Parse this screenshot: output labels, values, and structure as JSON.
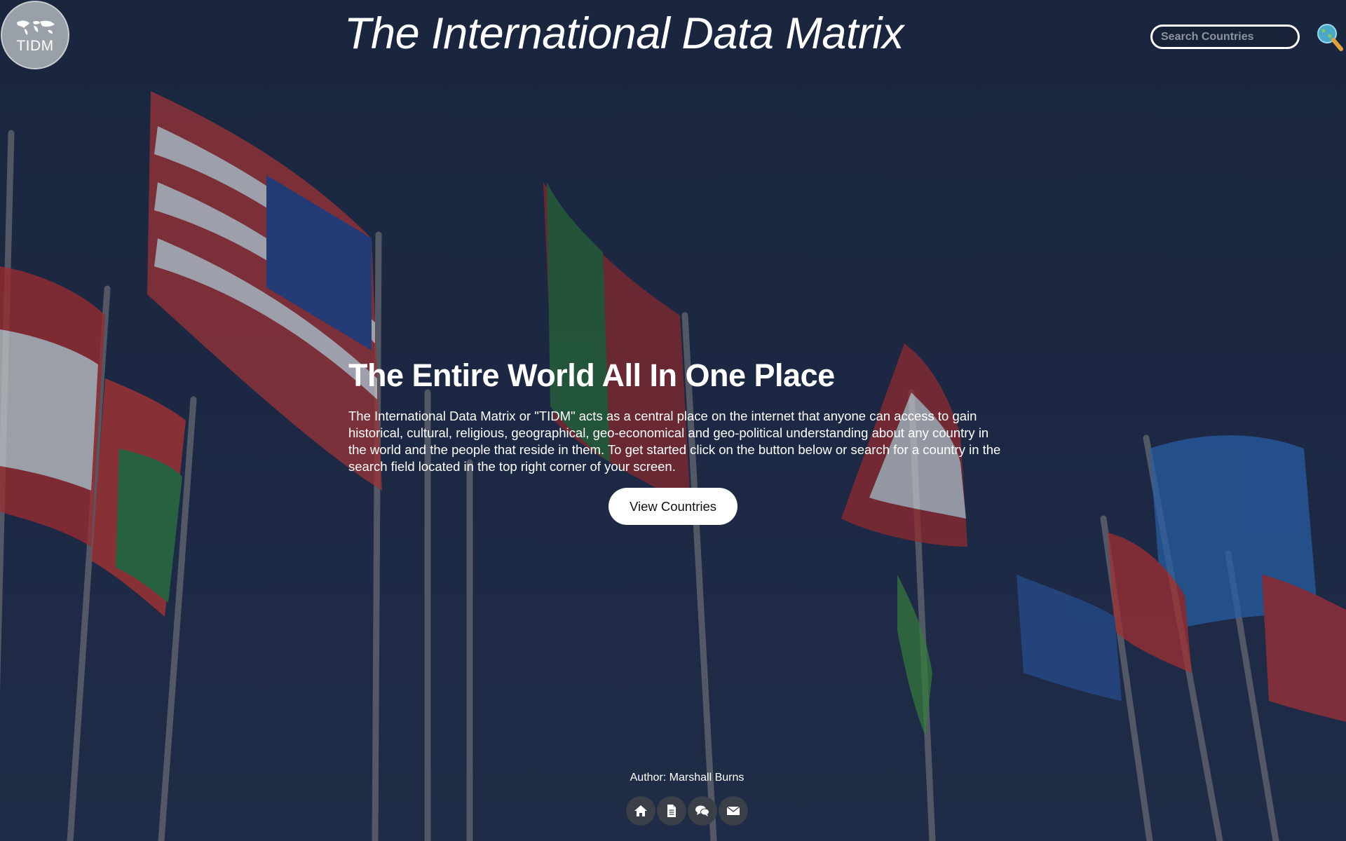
{
  "header": {
    "logo_text": "TIDM",
    "site_title": "The International Data Matrix",
    "search": {
      "placeholder": "Search Countries",
      "value": ""
    }
  },
  "hero": {
    "heading": "The Entire World All In One Place",
    "description": "The International Data Matrix or \"TIDM\" acts as a central place on the internet that anyone can access to gain historical, cultural, religious, geographical, geo-economical and geo-political understanding about any country in the world and the people that reside in them. To get started click on the button below or search for a country in the search field located in the top right corner of your screen.",
    "cta_label": "View Countries"
  },
  "footer": {
    "author": "Author: Marshall Burns",
    "icons": [
      "home-icon",
      "document-icon",
      "chat-icon",
      "mail-icon"
    ]
  },
  "colors": {
    "sky": "#1f2d4a",
    "text": "#ffffff",
    "footer_icon_bg": "#3a3f48"
  }
}
